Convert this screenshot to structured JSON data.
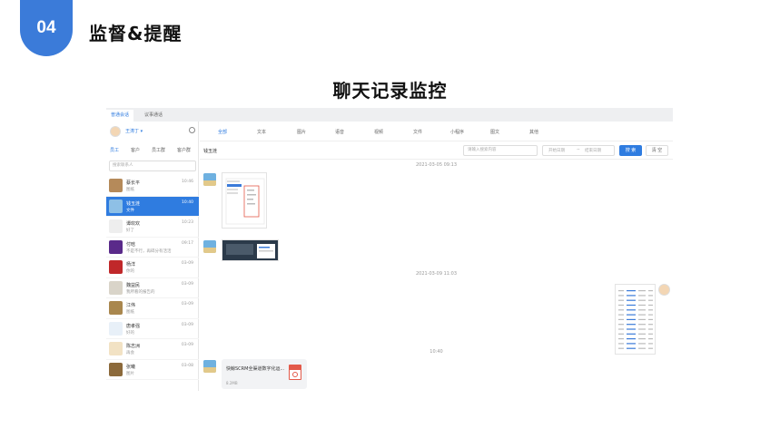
{
  "slide": {
    "badge": "04",
    "title": "监督&提醒",
    "main_title": "聊天记录监控"
  },
  "app": {
    "top_tabs": [
      "普通会话",
      "议事通话"
    ],
    "user": {
      "name": "王涛丁 ▾"
    },
    "sub_tabs": [
      "员工",
      "客户",
      "员工群",
      "客户群"
    ],
    "search_placeholder": "搜索联系人",
    "contacts": [
      {
        "name": "蔡长平",
        "sub": "图纸",
        "time": "10:46",
        "avatar_color": "#b58a5a"
      },
      {
        "name": "钱玉涟",
        "sub": "文件",
        "time": "10:40",
        "avatar_color": "#8ec0e6",
        "active": true
      },
      {
        "name": "谭欢欢",
        "sub": "好了",
        "time": "10:23",
        "avatar_color": "#eeeeee"
      },
      {
        "name": "付晗",
        "sub": "不是不行，再碎分有活活",
        "time": "09:17",
        "avatar_color": "#5a2a8a"
      },
      {
        "name": "杨洋",
        "sub": "你的",
        "time": "03-09",
        "avatar_color": "#c0282a"
      },
      {
        "name": "魏益民",
        "sub": "我所看的报告的",
        "time": "03-09",
        "avatar_color": "#d9d4c9"
      },
      {
        "name": "江伟",
        "sub": "图纸",
        "time": "03-09",
        "avatar_color": "#a9874e"
      },
      {
        "name": "唐孝强",
        "sub": "好的",
        "time": "03-09",
        "avatar_color": "#e8f0f8"
      },
      {
        "name": "陈志洲",
        "sub": "再会",
        "time": "03-09",
        "avatar_color": "#f2e2c4"
      },
      {
        "name": "张曦",
        "sub": "图片",
        "time": "03-08",
        "avatar_color": "#8c6a3b"
      }
    ],
    "filter_tabs": [
      "全部",
      "文本",
      "图片",
      "语音",
      "视频",
      "文件",
      "小程序",
      "图文",
      "其他"
    ],
    "chat": {
      "contact_name": "钱玉涟",
      "keyword_placeholder": "请输入搜索内容",
      "date_start": "开始日期",
      "date_sep": "~",
      "date_end": "结束日期",
      "search_button": "搜 索",
      "clear_button": "清 空"
    },
    "messages": {
      "ts1": "2021-03-05 09:13",
      "ts2": "2021-03-09 11:03",
      "ts3": "10:40",
      "file_name": "快鲸SCRM全渠道数字化运...",
      "file_size": "8.2MB"
    },
    "colors": {
      "accent": "#2f7ce0",
      "badge": "#3b7bd9"
    }
  }
}
